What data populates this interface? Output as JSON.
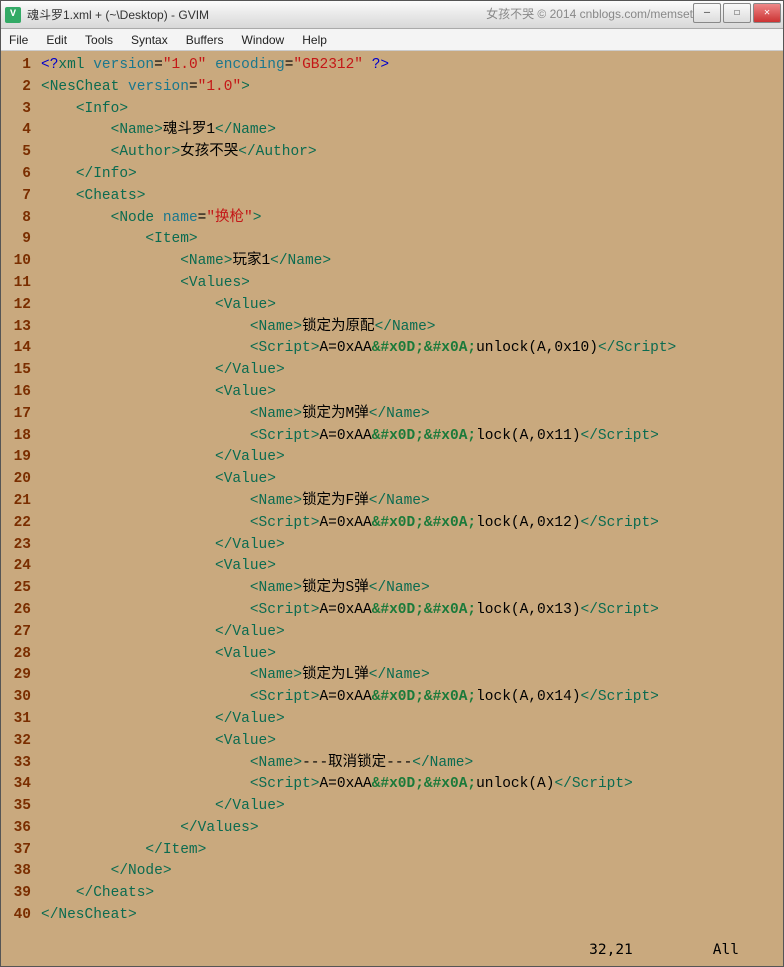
{
  "window": {
    "title": "魂斗罗1.xml + (~\\Desktop) - GVIM",
    "watermark": "女孩不哭 © 2014 cnblogs.com/memset"
  },
  "menu": [
    "File",
    "Edit",
    "Tools",
    "Syntax",
    "Buffers",
    "Window",
    "Help"
  ],
  "status": {
    "pos": "32,21",
    "mode": "All"
  },
  "code": {
    "lines": [
      {
        "n": 1,
        "html": "<span class='pi'>&lt;?</span><span class='tag'>xml</span> <span class='attr'>version</span>=<span class='str'>\"1.0\"</span> <span class='attr'>encoding</span>=<span class='str'>\"GB2312\"</span> <span class='pi'>?&gt;</span>"
      },
      {
        "n": 2,
        "html": "<span class='tag'>&lt;NesCheat</span> <span class='attr'>version</span>=<span class='str'>\"1.0\"</span><span class='tag'>&gt;</span>"
      },
      {
        "n": 3,
        "html": "    <span class='tag'>&lt;Info&gt;</span>"
      },
      {
        "n": 4,
        "html": "        <span class='tag'>&lt;Name&gt;</span><span class='txt'>魂斗罗1</span><span class='tag'>&lt;/Name&gt;</span>"
      },
      {
        "n": 5,
        "html": "        <span class='tag'>&lt;Author&gt;</span><span class='txt'>女孩不哭</span><span class='tag'>&lt;/Author&gt;</span>"
      },
      {
        "n": 6,
        "html": "    <span class='tag'>&lt;/Info&gt;</span>"
      },
      {
        "n": 7,
        "html": "    <span class='tag'>&lt;Cheats&gt;</span>"
      },
      {
        "n": 8,
        "html": "        <span class='tag'>&lt;Node</span> <span class='attr'>name</span>=<span class='str'>\"换枪\"</span><span class='tag'>&gt;</span>"
      },
      {
        "n": 9,
        "html": "            <span class='tag'>&lt;Item&gt;</span>"
      },
      {
        "n": 10,
        "html": "                <span class='tag'>&lt;Name&gt;</span><span class='txt'>玩家1</span><span class='tag'>&lt;/Name&gt;</span>"
      },
      {
        "n": 11,
        "html": "                <span class='tag'>&lt;Values&gt;</span>"
      },
      {
        "n": 12,
        "html": "                    <span class='tag'>&lt;Value&gt;</span>"
      },
      {
        "n": 13,
        "html": "                        <span class='tag'>&lt;Name&gt;</span><span class='txt'>锁定为原配</span><span class='tag'>&lt;/Name&gt;</span>"
      },
      {
        "n": 14,
        "html": "                        <span class='tag'>&lt;Script&gt;</span><span class='txt'>A=0xAA</span><span class='ent'>&amp;#x0D;&amp;#x0A;</span><span class='txt'>unlock(A,0x10)</span><span class='tag'>&lt;/Script&gt;</span>"
      },
      {
        "n": 15,
        "html": "                    <span class='tag'>&lt;/Value&gt;</span>"
      },
      {
        "n": 16,
        "html": "                    <span class='tag'>&lt;Value&gt;</span>"
      },
      {
        "n": 17,
        "html": "                        <span class='tag'>&lt;Name&gt;</span><span class='txt'>锁定为M弹</span><span class='tag'>&lt;/Name&gt;</span>"
      },
      {
        "n": 18,
        "html": "                        <span class='tag'>&lt;Script&gt;</span><span class='txt'>A=0xAA</span><span class='ent'>&amp;#x0D;&amp;#x0A;</span><span class='txt'>lock(A,0x11)</span><span class='tag'>&lt;/Script&gt;</span>"
      },
      {
        "n": 19,
        "html": "                    <span class='tag'>&lt;/Value&gt;</span>"
      },
      {
        "n": 20,
        "html": "                    <span class='tag'>&lt;Value&gt;</span>"
      },
      {
        "n": 21,
        "html": "                        <span class='tag'>&lt;Name&gt;</span><span class='txt'>锁定为F弹</span><span class='tag'>&lt;/Name&gt;</span>"
      },
      {
        "n": 22,
        "html": "                        <span class='tag'>&lt;Script&gt;</span><span class='txt'>A=0xAA</span><span class='ent'>&amp;#x0D;&amp;#x0A;</span><span class='txt'>lock(A,0x12)</span><span class='tag'>&lt;/Script&gt;</span>"
      },
      {
        "n": 23,
        "html": "                    <span class='tag'>&lt;/Value&gt;</span>"
      },
      {
        "n": 24,
        "html": "                    <span class='tag'>&lt;Value&gt;</span>"
      },
      {
        "n": 25,
        "html": "                        <span class='tag'>&lt;Name&gt;</span><span class='txt'>锁定为S弹</span><span class='tag'>&lt;/Name&gt;</span>"
      },
      {
        "n": 26,
        "html": "                        <span class='tag'>&lt;Script&gt;</span><span class='txt'>A=0xAA</span><span class='ent'>&amp;#x0D;&amp;#x0A;</span><span class='txt'>lock(A,0x13)</span><span class='tag'>&lt;/Script&gt;</span>"
      },
      {
        "n": 27,
        "html": "                    <span class='tag'>&lt;/Value&gt;</span>"
      },
      {
        "n": 28,
        "html": "                    <span class='tag'>&lt;Value&gt;</span>"
      },
      {
        "n": 29,
        "html": "                        <span class='tag'>&lt;Name&gt;</span><span class='txt'>锁定为L弹</span><span class='tag'>&lt;/Name&gt;</span>"
      },
      {
        "n": 30,
        "html": "                        <span class='tag'>&lt;Script&gt;</span><span class='txt'>A=0xAA</span><span class='ent'>&amp;#x0D;&amp;#x0A;</span><span class='txt'>lock(A,0x14)</span><span class='tag'>&lt;/Script&gt;</span>"
      },
      {
        "n": 31,
        "html": "                    <span class='tag'>&lt;/Value&gt;</span>"
      },
      {
        "n": 32,
        "html": "                    <span class='tag'>&lt;Value&gt;</span>"
      },
      {
        "n": 33,
        "html": "                        <span class='tag'>&lt;Name&gt;</span><span class='txt'>---取消锁定---</span><span class='tag'>&lt;/Name&gt;</span>"
      },
      {
        "n": 34,
        "html": "                        <span class='tag'>&lt;Script&gt;</span><span class='txt'>A=0xAA</span><span class='ent'>&amp;#x0D;&amp;#x0A;</span><span class='txt'>unlock(A)</span><span class='tag'>&lt;/Script&gt;</span>"
      },
      {
        "n": 35,
        "html": "                    <span class='tag'>&lt;/Value&gt;</span>"
      },
      {
        "n": 36,
        "html": "                <span class='tag'>&lt;/Values&gt;</span>"
      },
      {
        "n": 37,
        "html": "            <span class='tag'>&lt;/Item&gt;</span>"
      },
      {
        "n": 38,
        "html": "        <span class='tag'>&lt;/Node&gt;</span>"
      },
      {
        "n": 39,
        "html": "    <span class='tag'>&lt;/Cheats&gt;</span>"
      },
      {
        "n": 40,
        "html": "<span class='tag'>&lt;/NesCheat&gt;</span>"
      }
    ]
  }
}
